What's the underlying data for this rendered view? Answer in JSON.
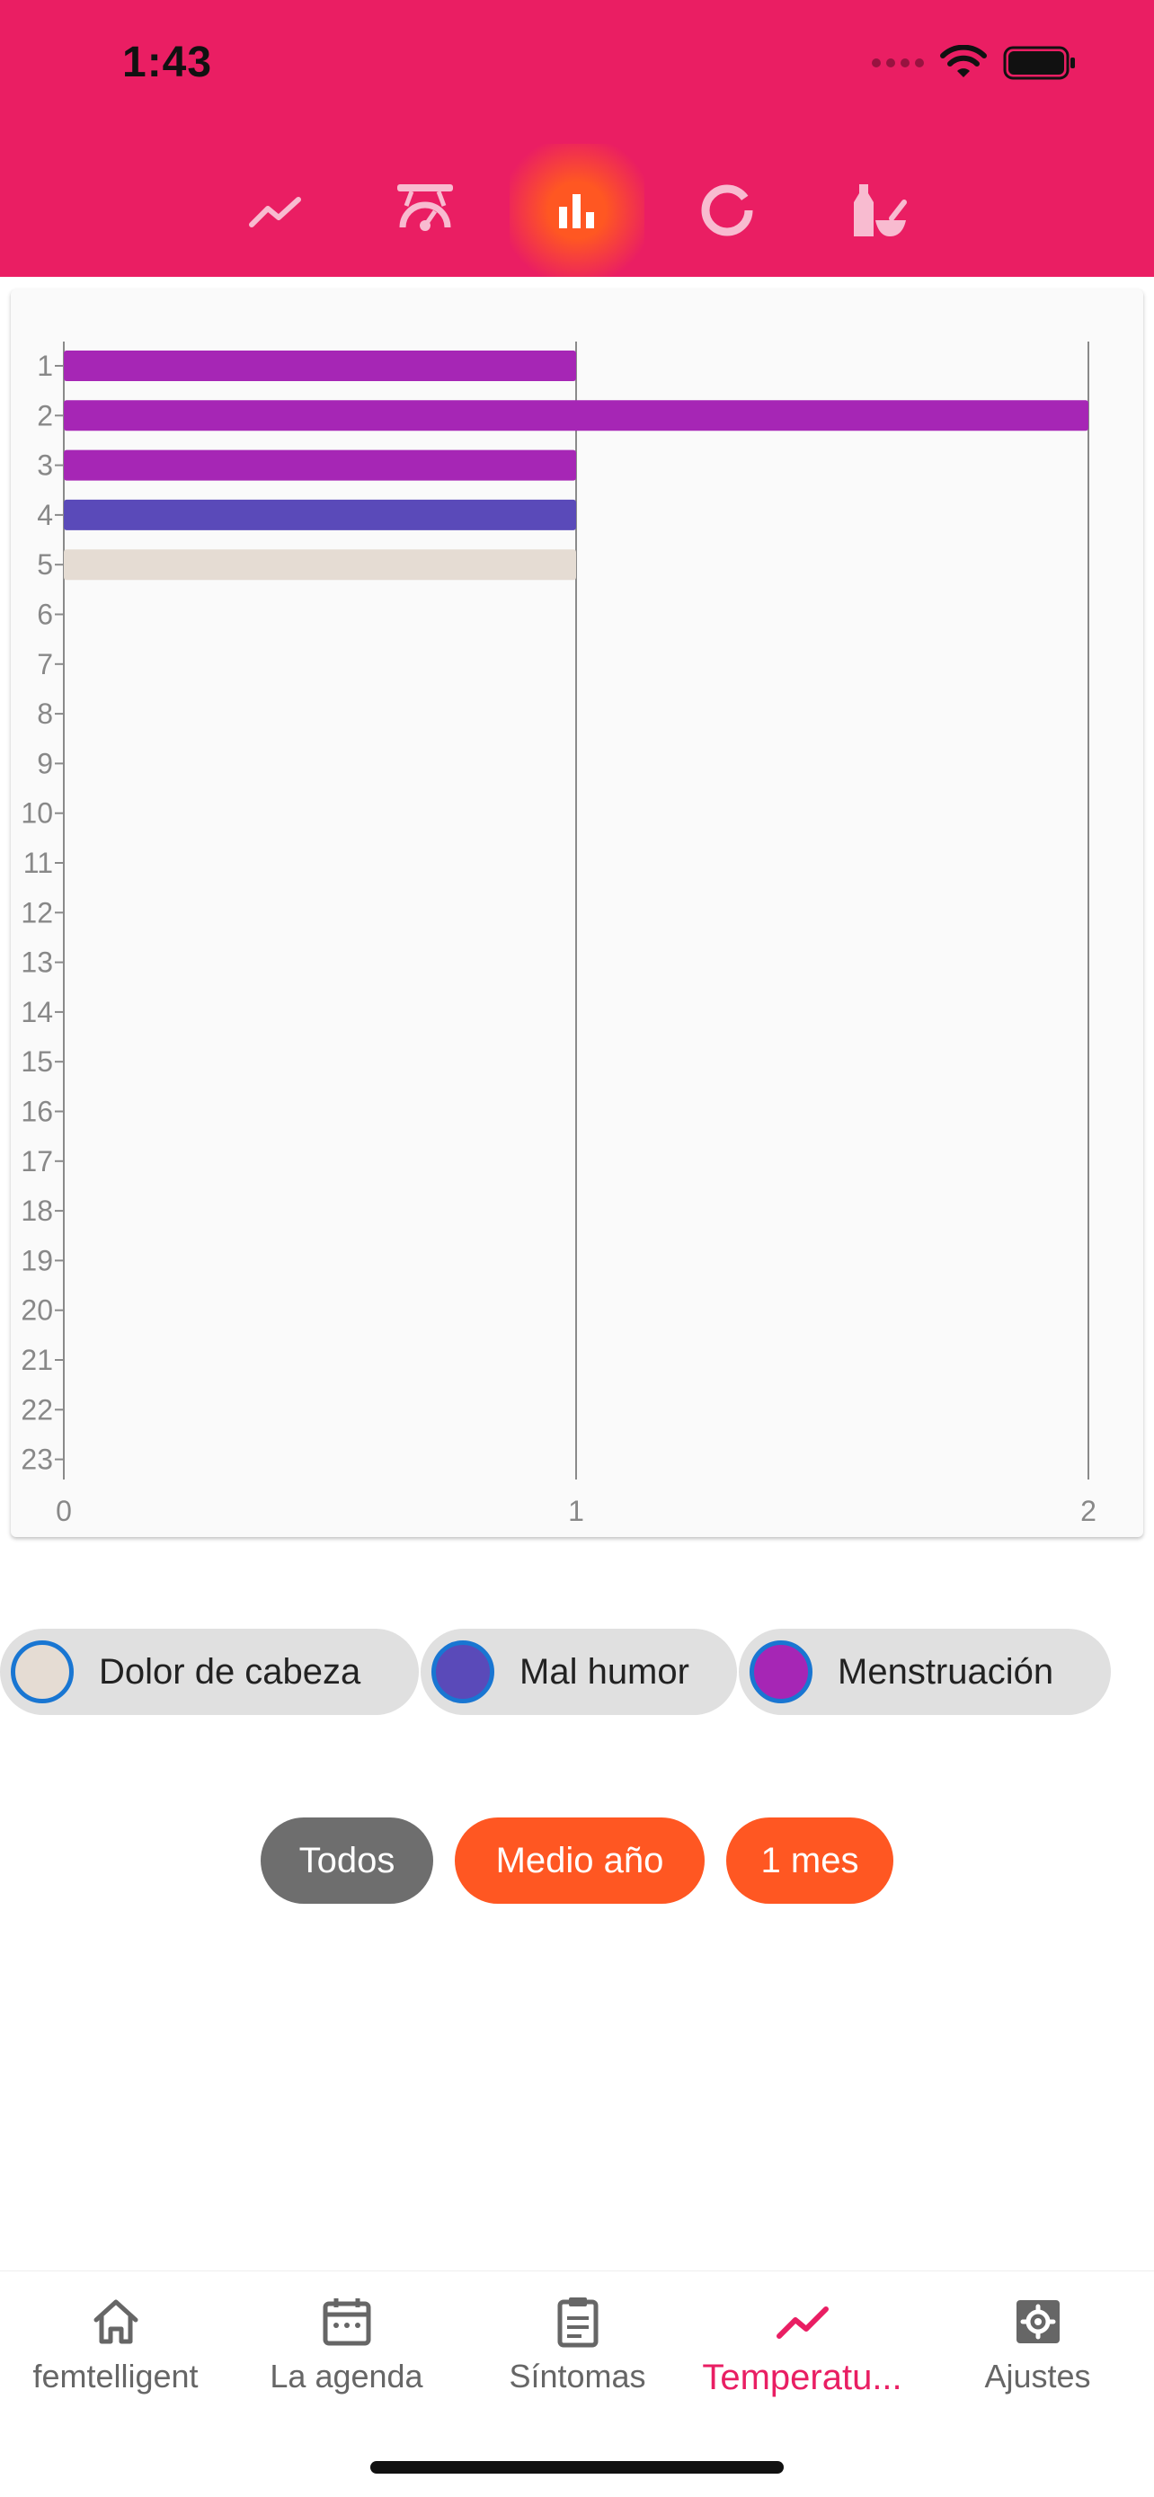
{
  "status": {
    "time": "1:43"
  },
  "top_tabs": [
    {
      "icon": "line-chart-icon",
      "active": false
    },
    {
      "icon": "gauge-icon",
      "active": false
    },
    {
      "icon": "bar-chart-icon",
      "active": true
    },
    {
      "icon": "donut-icon",
      "active": false
    },
    {
      "icon": "mortar-pestle-icon",
      "active": false
    }
  ],
  "colors": {
    "header": "#EA1E63",
    "accent": "#FF5722",
    "menstruacion": "#A626B5",
    "mal_humor": "#5A4AB9",
    "dolor_de_cabeza": "#E5DCD3",
    "neutral_button": "#6E6E6E",
    "active_nav": "#E91E63"
  },
  "chart_data": {
    "type": "bar",
    "orientation": "horizontal",
    "categories": [
      "1",
      "2",
      "3",
      "4",
      "5",
      "6",
      "7",
      "8",
      "9",
      "10",
      "11",
      "12",
      "13",
      "14",
      "15",
      "16",
      "17",
      "18",
      "19",
      "20",
      "21",
      "22",
      "23"
    ],
    "values": [
      1,
      2,
      1,
      1,
      1,
      0,
      0,
      0,
      0,
      0,
      0,
      0,
      0,
      0,
      0,
      0,
      0,
      0,
      0,
      0,
      0,
      0,
      0
    ],
    "bar_series": [
      "Menstruación",
      "Menstruación",
      "Menstruación",
      "Mal humor",
      "Dolor de cabeza"
    ],
    "xlim": [
      0,
      2
    ],
    "x_ticks": [
      "0",
      "1",
      "2"
    ],
    "grid": true
  },
  "legend": [
    {
      "label": "Dolor de cabeza",
      "color": "#E5DCD3"
    },
    {
      "label": "Mal humor",
      "color": "#5A4AB9"
    },
    {
      "label": "Menstruación",
      "color": "#A626B5"
    }
  ],
  "filters": [
    {
      "label": "Todos",
      "color": "#6E6E6E"
    },
    {
      "label": "Medio año",
      "color": "#FF5722"
    },
    {
      "label": "1 mes",
      "color": "#FF5722"
    }
  ],
  "bottom_nav": [
    {
      "label": "femtelligent",
      "icon": "home-icon",
      "active": false
    },
    {
      "label": "La agenda",
      "icon": "calendar-icon",
      "active": false
    },
    {
      "label": "Síntomas",
      "icon": "clipboard-icon",
      "active": false
    },
    {
      "label": "Temperatu...",
      "icon": "trending-icon",
      "active": true
    },
    {
      "label": "Ajustes",
      "icon": "settings-icon",
      "active": false
    }
  ]
}
